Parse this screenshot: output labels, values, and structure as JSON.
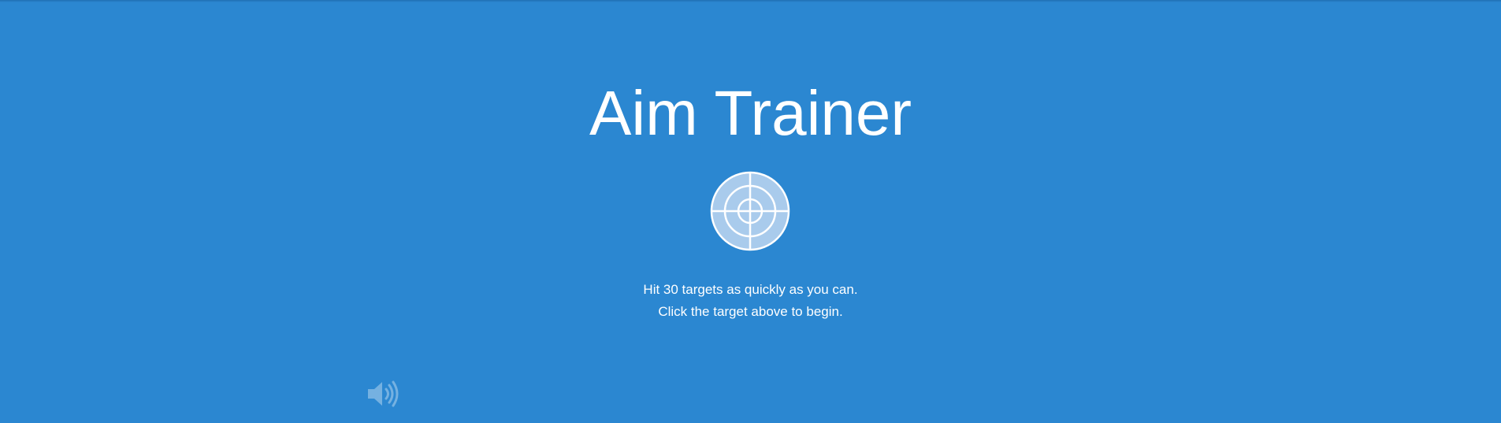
{
  "app": {
    "title": "Aim Trainer"
  },
  "start_screen": {
    "target_icon": "bullseye-target-icon",
    "instructions": {
      "line1": "Hit 30 targets as quickly as you can.",
      "line2": "Click the target above to begin."
    }
  },
  "controls": {
    "sound_icon": "speaker-volume-icon"
  },
  "colors": {
    "background": "#2b87d1",
    "text": "#ffffff",
    "target_fill": "#a9cbec"
  }
}
